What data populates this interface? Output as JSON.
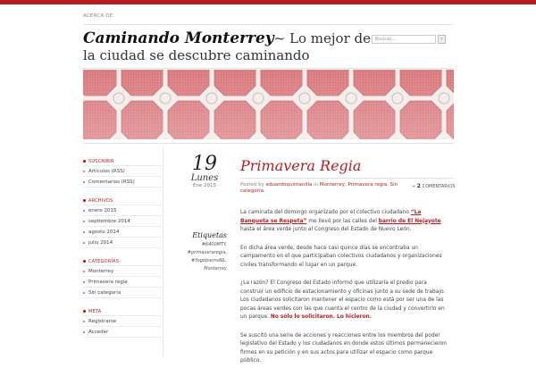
{
  "nav": {
    "about": "ACERCA DE"
  },
  "site": {
    "title": "Caminando Monterrey",
    "separator": "~",
    "tagline": "Lo mejor de la ciudad se descubre caminando"
  },
  "search": {
    "placeholder": "Buscar..."
  },
  "sidebar": {
    "sections": [
      {
        "title": "SUSCRIBIR",
        "items": [
          "Artículos (RSS)",
          "Comentarios (RSS)"
        ]
      },
      {
        "title": "ARCHIVOS",
        "items": [
          "enero 2015",
          "septiembre 2014",
          "agosto 2014",
          "julio 2014"
        ]
      },
      {
        "title": "CATEGORÍAS",
        "items": [
          "Monterrey",
          "Primavera regia",
          "Sin categoría"
        ]
      },
      {
        "title": "META",
        "items": [
          "Registrarse",
          "Acceder"
        ]
      }
    ]
  },
  "post": {
    "day": "19",
    "weekday": "Lunes",
    "month_year": "Ene 2015",
    "title": "Primavera Regia",
    "meta_prefix": "Posted by",
    "author": "eduardoquintanilla",
    "meta_in": "in",
    "categories": "Monterrey, Primavera regia, Sin categoría",
    "comments_count": "2",
    "comments_label": "COMENTARIOS",
    "tags_heading": "Etiquetas",
    "tags": [
      "#6400MTY,",
      "#primaveraregia,",
      "#YogobiernoNL,",
      "Monterrey"
    ],
    "paragraphs": [
      {
        "t1": "La caminata del domingo organizado por el colectivo ciudadano ",
        "l1": "“La Banqueta se Respeta”",
        "t2": " me llevó por las calles del ",
        "l2": "barrio de El Nejayote",
        "t3": " hasta el área verde junto al Congreso del Estado de Nuevo León."
      },
      {
        "text": "En dicha área verde, desde hace casi quince días se encontraba un campamento en el que participaban colectivos ciudadanos y organizaciones civiles transformando el lugar en un parque."
      },
      {
        "text": "¿La razón? El Congreso del Estado informó que utilizaría el predio para construir un edificio de estacionamiento y oficinas junto a su sede de trabajo. Los ciudadanos solicitaron mantener el espacio como está por ser una de las pocas áreas verdes con las que cuenta el centro de la ciudad y convertirlo en un parque.",
        "bold": "No sólo lo solicitaron. Lo hicieron."
      },
      {
        "text": "Se suscitó una serie de acciones y reacciones entre los miembros del poder legislativo del Estado y los ciudadanos en donde estos últimos permanecieron firmes en su petición y en sus actos para utilizar  el espacio como parque público."
      }
    ]
  },
  "colors": {
    "accent": "#b71d20",
    "tile_red": "#d86a6e",
    "tile_light": "#f2ecea"
  }
}
